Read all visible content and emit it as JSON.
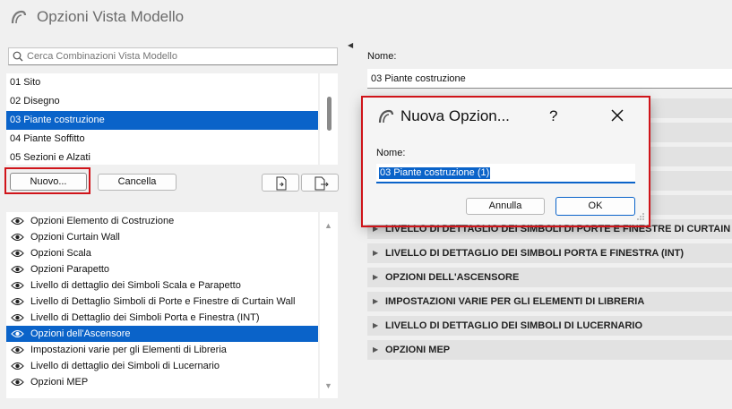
{
  "window": {
    "title": "Opzioni Vista Modello"
  },
  "search": {
    "placeholder": "Cerca Combinazioni Vista Modello"
  },
  "combinations": {
    "items": [
      {
        "label": "01 Sito",
        "selected": false
      },
      {
        "label": "02 Disegno",
        "selected": false
      },
      {
        "label": "03 Piante costruzione",
        "selected": true
      },
      {
        "label": "04 Piante Soffitto",
        "selected": false
      },
      {
        "label": "05 Sezioni e Alzati",
        "selected": false
      }
    ]
  },
  "buttons": {
    "new_label": "Nuovo...",
    "delete_label": "Cancella"
  },
  "options": {
    "items": [
      {
        "label": "Opzioni Elemento di Costruzione",
        "selected": false
      },
      {
        "label": "Opzioni Curtain Wall",
        "selected": false
      },
      {
        "label": "Opzioni Scala",
        "selected": false
      },
      {
        "label": "Opzioni Parapetto",
        "selected": false
      },
      {
        "label": "Livello di dettaglio dei Simboli Scala e Parapetto",
        "selected": false
      },
      {
        "label": "Livello di Dettaglio Simboli di Porte e Finestre di Curtain Wall",
        "selected": false
      },
      {
        "label": "Livello di Dettaglio dei Simboli Porta e Finestra (INT)",
        "selected": false
      },
      {
        "label": "Opzioni dell'Ascensore",
        "selected": true
      },
      {
        "label": "Impostazioni varie per gli Elementi di Libreria",
        "selected": false
      },
      {
        "label": "Livello di dettaglio dei Simboli di Lucernario",
        "selected": false
      },
      {
        "label": "Opzioni MEP",
        "selected": false
      }
    ]
  },
  "detail": {
    "name_label": "Nome:",
    "name_value": "03 Piante costruzione",
    "sections": [
      {
        "label": ""
      },
      {
        "label": ""
      },
      {
        "label": ""
      },
      {
        "label": ""
      },
      {
        "label": ""
      },
      {
        "label": "LIVELLO DI DETTAGLIO DEI SIMBOLI DI PORTE E FINESTRE DI CURTAIN WALL"
      },
      {
        "label": "LIVELLO DI DETTAGLIO DEI SIMBOLI PORTA E FINESTRA (INT)"
      },
      {
        "label": "OPZIONI DELL'ASCENSORE"
      },
      {
        "label": "IMPOSTAZIONI VARIE PER GLI ELEMENTI DI LIBRERIA"
      },
      {
        "label": "LIVELLO DI DETTAGLIO DEI SIMBOLI DI LUCERNARIO"
      },
      {
        "label": "OPZIONI MEP"
      }
    ]
  },
  "dialog": {
    "title": "Nuova Opzion...",
    "help": "?",
    "name_label": "Nome:",
    "name_value": "03 Piante costruzione (1)",
    "cancel_label": "Annulla",
    "ok_label": "OK"
  },
  "colors": {
    "selection": "#0a63c9",
    "highlight": "#d0141a",
    "section_bg": "#e2e2e2"
  }
}
